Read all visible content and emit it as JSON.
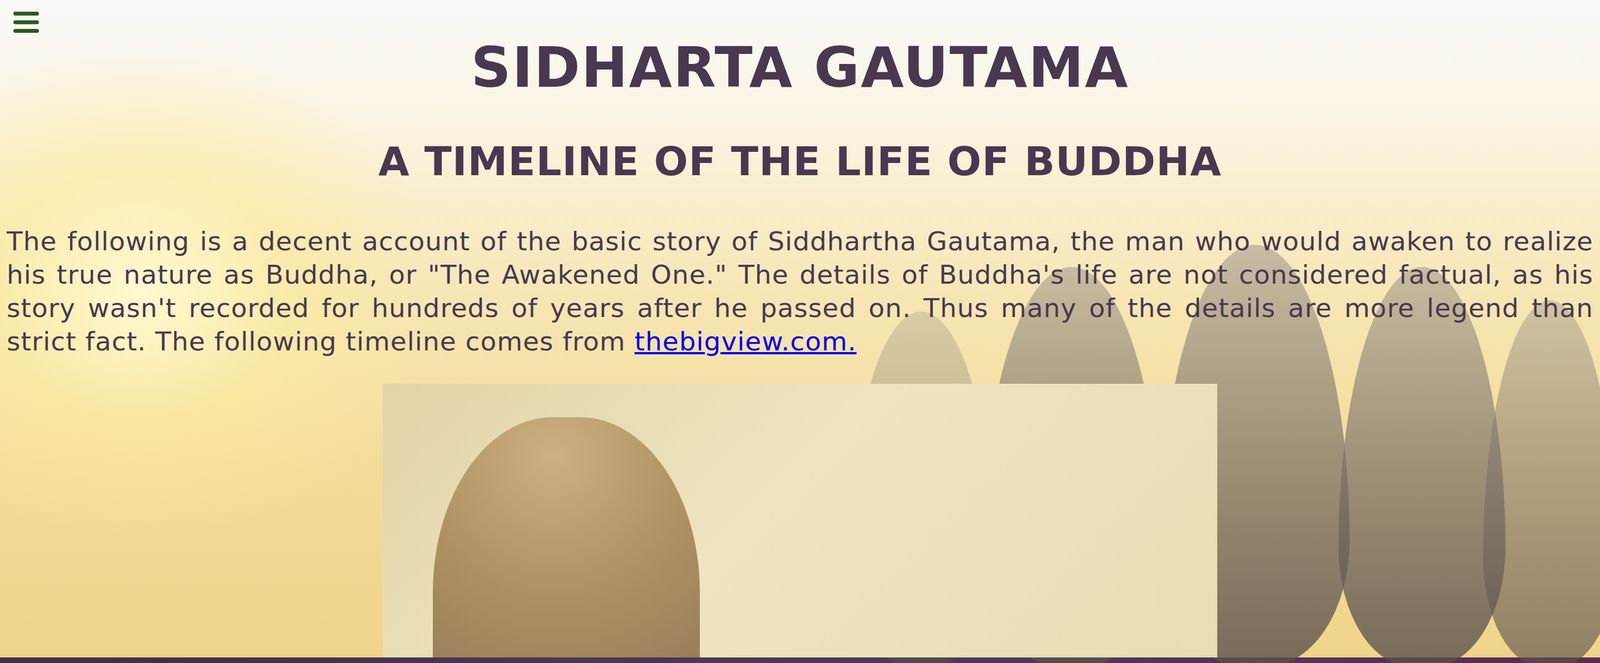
{
  "page": {
    "title": "SIDHARTA GAUTAMA",
    "subtitle": "A TIMELINE OF THE LIFE OF BUDDHA"
  },
  "intro": {
    "text": "The following is a decent account of the basic story of Siddhartha Gautama, the man who would awaken to realize his true nature as Buddha, or \"The Awakened One.\" The details of Buddha's life are not considered factual, as his story wasn't recorded for hundreds of years after he passed on. Thus many of the details are more legend than strict fact. The following timeline comes from ",
    "link": "thebigview.com."
  }
}
